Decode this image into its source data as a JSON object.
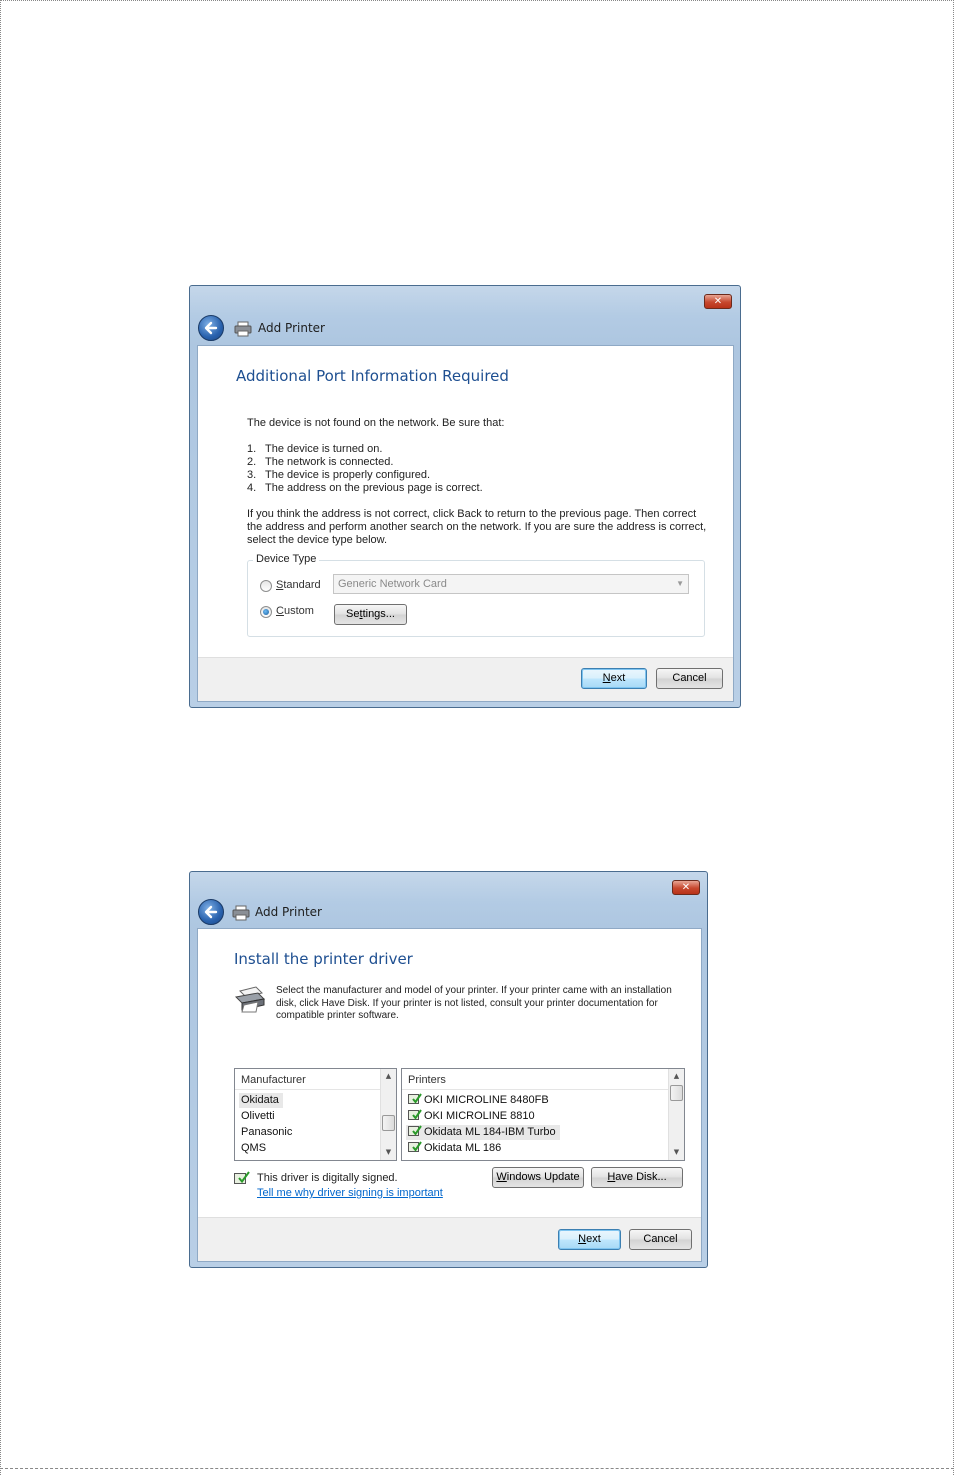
{
  "dialog1": {
    "title": "Add Printer",
    "close_label": "✕",
    "heading": "Additional Port Information Required",
    "intro": "The device is not found on the network.  Be sure that:",
    "checklist": [
      {
        "num": "1.",
        "text": "The device is turned on."
      },
      {
        "num": "2.",
        "text": "The network is connected."
      },
      {
        "num": "3.",
        "text": "The device is properly configured."
      },
      {
        "num": "4.",
        "text": "The address on the previous page is correct."
      }
    ],
    "paragraph": [
      "If you think the address is not correct, click Back to return to the previous page.  Then correct",
      "the address and perform another search on the network.  If you are sure the address is correct,",
      "select the device type below."
    ],
    "device_type": {
      "legend": "Device Type",
      "standard_label_first": "S",
      "standard_label_rest": "tandard",
      "standard_selected": false,
      "standard_value": "Generic Network Card",
      "custom_label_first": "C",
      "custom_label_rest": "ustom",
      "custom_selected": true,
      "settings_first": "Se",
      "settings_u": "t",
      "settings_rest": "tings..."
    },
    "next_first": "N",
    "next_rest": "ext",
    "cancel_label": "Cancel"
  },
  "dialog2": {
    "title": "Add Printer",
    "close_label": "✕",
    "heading": "Install the printer driver",
    "description": [
      "Select the manufacturer and model of your printer. If your printer came with an installation",
      "disk, click Have Disk. If your printer is not listed, consult your printer documentation for",
      "compatible printer software."
    ],
    "manufacturer": {
      "header": "Manufacturer",
      "items": [
        "Okidata",
        "Olivetti",
        "Panasonic",
        "QMS"
      ],
      "selected_index": 0
    },
    "printers": {
      "header": "Printers",
      "items": [
        "OKI MICROLINE 8480FB",
        "OKI MICROLINE 8810",
        "Okidata ML 184-IBM Turbo",
        "Okidata ML 186"
      ],
      "selected_index": 2
    },
    "signed_text": "This driver is digitally signed.",
    "signing_link": "Tell me why driver signing is important",
    "windows_update_first": "W",
    "windows_update_rest": "indows Update",
    "have_disk_first": "H",
    "have_disk_rest": "ave Disk...",
    "next_first": "N",
    "next_rest": "ext",
    "cancel_label": "Cancel"
  },
  "colors": {
    "heading_blue": "#1e4f91",
    "link_blue": "#0066cc",
    "close_red": "#c7482e",
    "titlebar_blue": "#b3cbe4"
  }
}
